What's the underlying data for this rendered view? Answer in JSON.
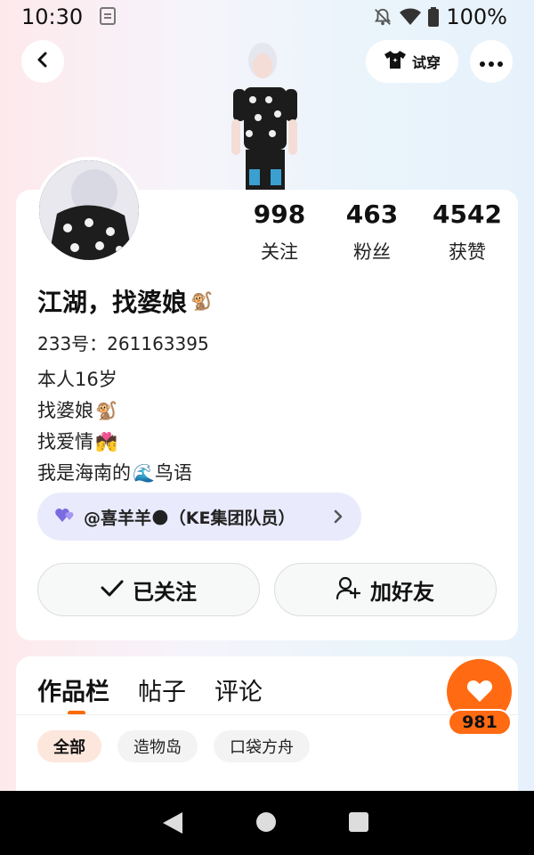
{
  "status_bar": {
    "time": "10:30",
    "battery_pct": "100%"
  },
  "header": {
    "try_on_label": "试穿"
  },
  "profile": {
    "stats": [
      {
        "value": "998",
        "label": "关注"
      },
      {
        "value": "463",
        "label": "粉丝"
      },
      {
        "value": "4542",
        "label": "获赞"
      }
    ],
    "username": "江湖，找婆娘",
    "username_emoji": "🐒",
    "id_line": "233号：261163395",
    "bio": [
      {
        "text": "本人16岁",
        "emoji": ""
      },
      {
        "text": "找婆娘",
        "emoji": "🐒"
      },
      {
        "text": "找爱情",
        "emoji": "💏"
      },
      {
        "text": "我是海南的",
        "emoji": "🌊",
        "suffix": "鸟语"
      }
    ],
    "team_tag": "@喜羊羊🌑（KE集团队员）",
    "followed_label": "已关注",
    "add_friend_label": "加好友"
  },
  "content": {
    "tabs": [
      "作品栏",
      "帖子",
      "评论"
    ],
    "filters": [
      "全部",
      "造物岛",
      "口袋方舟"
    ],
    "like_count": "981"
  },
  "colors": {
    "accent": "#ff6a12",
    "tag_bg": "#e9eafb",
    "chip_active_bg": "#fde6dc"
  }
}
